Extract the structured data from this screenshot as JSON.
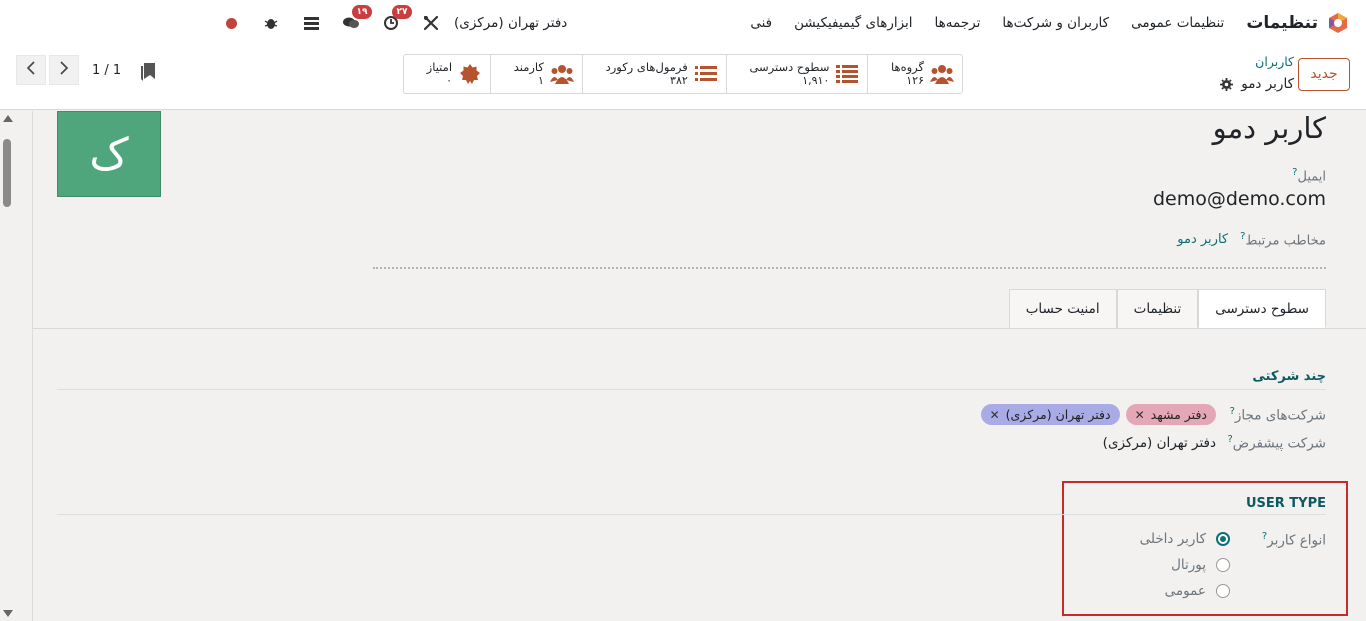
{
  "navbar": {
    "app_title": "تنظیمات",
    "menu": [
      "تنظیمات عمومی",
      "کاربران و شرکت‌ها",
      "ترجمه‌ها",
      "ابزارهای گیمیفیکیشن",
      "فنی"
    ],
    "company": "دفتر تهران (مرکزی)",
    "activity_count": "۲۷",
    "messages_count": "۱۹",
    "icons": [
      "odoo-logo-icon",
      "tools-icon",
      "activity-clock-icon",
      "chat-icon",
      "database-icon",
      "bug-icon",
      "status-dot-icon"
    ]
  },
  "controlpanel": {
    "new_button": "جدید",
    "breadcrumb_parent": "کاربران",
    "breadcrumb_current": "کاربر دمو",
    "pager_value": "1 / 1",
    "stats": [
      {
        "label": "گروه‌ها",
        "value": "۱۲۶",
        "icon": "users-icon"
      },
      {
        "label": "سطوح دسترسی",
        "value": "۱,۹۱۰",
        "icon": "list-icon"
      },
      {
        "label": "فرمول‌های رکورد",
        "value": "۳۸۲",
        "icon": "list-icon"
      },
      {
        "label": "کارمند",
        "value": "۱",
        "icon": "users-icon"
      },
      {
        "label": "امتیاز",
        "value": "۰",
        "icon": "badge-icon"
      }
    ]
  },
  "form": {
    "avatar_letter": "ک",
    "name": "کاربر دمو",
    "email_label": "ایمیل",
    "email": "demo@demo.com",
    "partner_label": "مخاطب مرتبط",
    "partner_value": "کاربر دمو",
    "help_mark": "?",
    "tabs": [
      "سطوح دسترسی",
      "تنظیمات",
      "امنیت حساب"
    ],
    "multi_company": {
      "title": "چند شرکتی",
      "allowed_label": "شرکت‌های مجاز",
      "allowed_tags": [
        "دفتر مشهد",
        "دفتر تهران (مرکزی)"
      ],
      "default_label": "شرکت پیشفرض",
      "default_value": "دفتر تهران (مرکزی)"
    },
    "user_type": {
      "title": "USER TYPE",
      "label": "انواع کاربر",
      "options": [
        "کاربر داخلی",
        "پورتال",
        "عمومی"
      ],
      "selected": "کاربر داخلی"
    }
  },
  "colors": {
    "brand": "#b5532e",
    "link": "#0b7077",
    "avatar": "#4fa57c",
    "highlight": "#c62a2a"
  }
}
